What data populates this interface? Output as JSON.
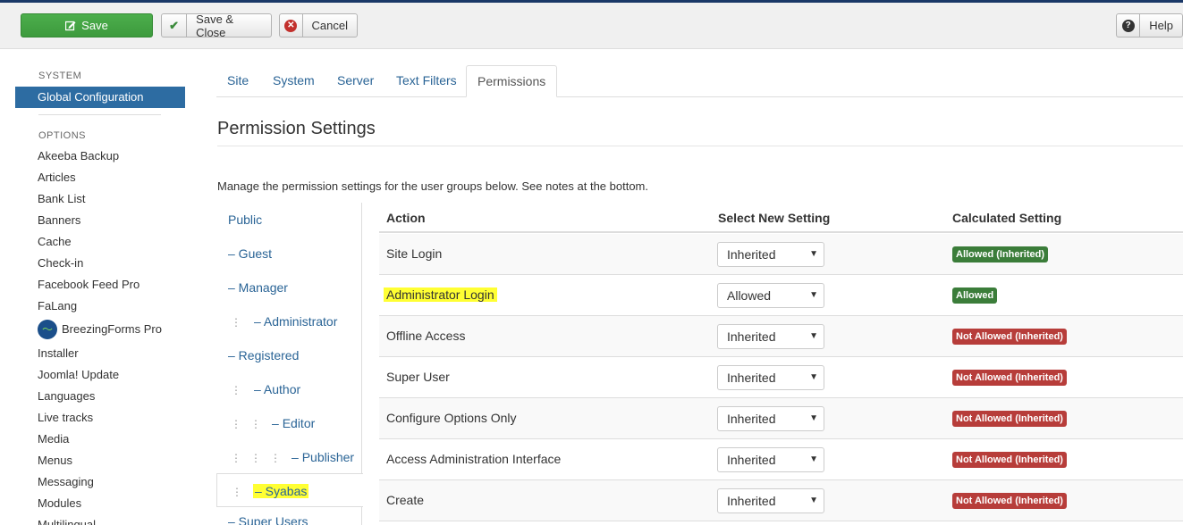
{
  "toolbar": {
    "save_label": "Save",
    "save_close_label": "Save & Close",
    "cancel_label": "Cancel",
    "help_label": "Help"
  },
  "sidebar": {
    "system_heading": "SYSTEM",
    "active_item": "Global Configuration",
    "options_heading": "OPTIONS",
    "items": [
      "Akeeba Backup",
      "Articles",
      "Bank List",
      "Banners",
      "Cache",
      "Check-in",
      "Facebook Feed Pro",
      "FaLang",
      "BreezingForms Pro",
      "Installer",
      "Joomla! Update",
      "Languages",
      "Live tracks",
      "Media",
      "Menus",
      "Messaging",
      "Modules",
      "Multilingual"
    ]
  },
  "tabs": [
    "Site",
    "System",
    "Server",
    "Text Filters",
    "Permissions"
  ],
  "active_tab": "Permissions",
  "page_title": "Permission Settings",
  "description": "Manage the permission settings for the user groups below. See notes at the bottom.",
  "groups": [
    {
      "dots": "",
      "label": "Public"
    },
    {
      "dots": "",
      "label": "– Guest"
    },
    {
      "dots": "",
      "label": "– Manager"
    },
    {
      "dots": "⋮",
      "label": "– Administrator"
    },
    {
      "dots": "",
      "label": "– Registered"
    },
    {
      "dots": "⋮",
      "label": "– Author"
    },
    {
      "dots": "⋮   ⋮",
      "label": "– Editor"
    },
    {
      "dots": "⋮   ⋮   ⋮",
      "label": "– Publisher"
    },
    {
      "dots": "⋮",
      "label": "– Syabas"
    },
    {
      "dots": "",
      "label": "– Super Users"
    }
  ],
  "table": {
    "col_action": "Action",
    "col_select": "Select New Setting",
    "col_calc": "Calculated Setting",
    "rows": [
      {
        "action": "Site Login",
        "setting": "Inherited",
        "calculated": "Allowed (Inherited)",
        "status": "allowed"
      },
      {
        "action": "Administrator Login",
        "setting": "Allowed",
        "calculated": "Allowed",
        "status": "allowed"
      },
      {
        "action": "Offline Access",
        "setting": "Inherited",
        "calculated": "Not Allowed (Inherited)",
        "status": "denied"
      },
      {
        "action": "Super User",
        "setting": "Inherited",
        "calculated": "Not Allowed (Inherited)",
        "status": "denied"
      },
      {
        "action": "Configure Options Only",
        "setting": "Inherited",
        "calculated": "Not Allowed (Inherited)",
        "status": "denied"
      },
      {
        "action": "Access Administration Interface",
        "setting": "Inherited",
        "calculated": "Not Allowed (Inherited)",
        "status": "denied"
      },
      {
        "action": "Create",
        "setting": "Inherited",
        "calculated": "Not Allowed (Inherited)",
        "status": "denied"
      }
    ]
  },
  "colors": {
    "allowed": "#3b7d3a",
    "denied": "#b73d3a",
    "active_sidebar": "#2d6ca2",
    "highlight": "#ffff33"
  }
}
